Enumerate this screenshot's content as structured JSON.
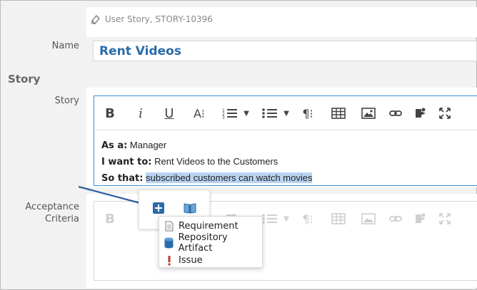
{
  "artifact": {
    "reference": "User Story, STORY-10396"
  },
  "name_field": {
    "label": "Name",
    "value": "Rent Videos"
  },
  "section": {
    "title": "Story"
  },
  "story_field": {
    "label": "Story",
    "toolbar": {
      "bold": "B",
      "italic": "i",
      "underline": "U",
      "font_size": "A⁝",
      "paragraph": "¶⁝"
    },
    "lines": [
      {
        "label": "As a:",
        "text": "Manager"
      },
      {
        "label": "I want to:",
        "text": "Rent Videos to the Customers"
      },
      {
        "label": "So that:",
        "text": "subscribed customers can watch movies"
      }
    ]
  },
  "acceptance_field": {
    "label_line1": "Acceptance",
    "label_line2": "Criteria"
  },
  "insert_menu": {
    "items": [
      {
        "label": "Requirement",
        "icon": "document-icon"
      },
      {
        "label": "Repository Artifact",
        "icon": "database-icon"
      },
      {
        "label": "Issue",
        "icon": "exclamation-icon"
      }
    ]
  },
  "colors": {
    "accent": "#2a6ca8",
    "focus_border": "#3b8fd4",
    "selection": "#b9d3f2",
    "arrow": "#2e5fa0",
    "issue": "#c0392b"
  }
}
